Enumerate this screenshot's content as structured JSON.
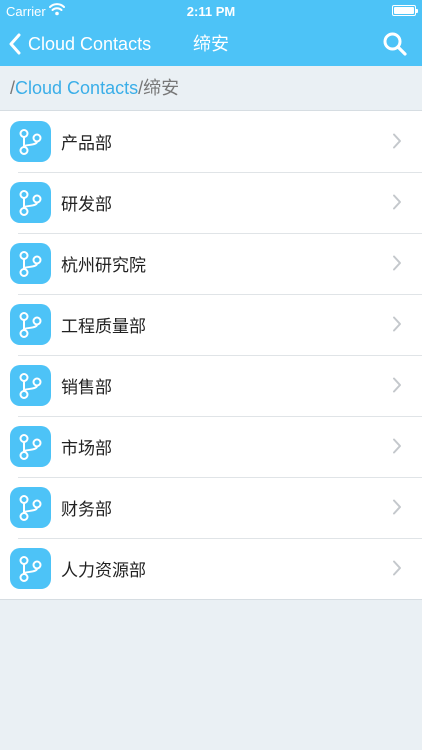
{
  "status_bar": {
    "carrier": "Carrier",
    "time": "2:11 PM",
    "battery_level": 1.0
  },
  "nav": {
    "back_label": "Cloud Contacts",
    "title": "缔安"
  },
  "breadcrumb": {
    "separator": "/",
    "link": "Cloud Contacts",
    "current": "缔安"
  },
  "departments": [
    {
      "label": "产品部"
    },
    {
      "label": "研发部"
    },
    {
      "label": "杭州研究院"
    },
    {
      "label": "工程质量部"
    },
    {
      "label": "销售部"
    },
    {
      "label": "市场部"
    },
    {
      "label": "财务部"
    },
    {
      "label": "人力资源部"
    }
  ],
  "icons": {
    "row_icon": "org-branch-icon",
    "row_chevron": "chevron-right-icon",
    "back": "chevron-left-icon",
    "search": "search-icon"
  },
  "colors": {
    "accent": "#4dc3f7",
    "link": "#3aaee8",
    "background": "#eaf0f4"
  }
}
